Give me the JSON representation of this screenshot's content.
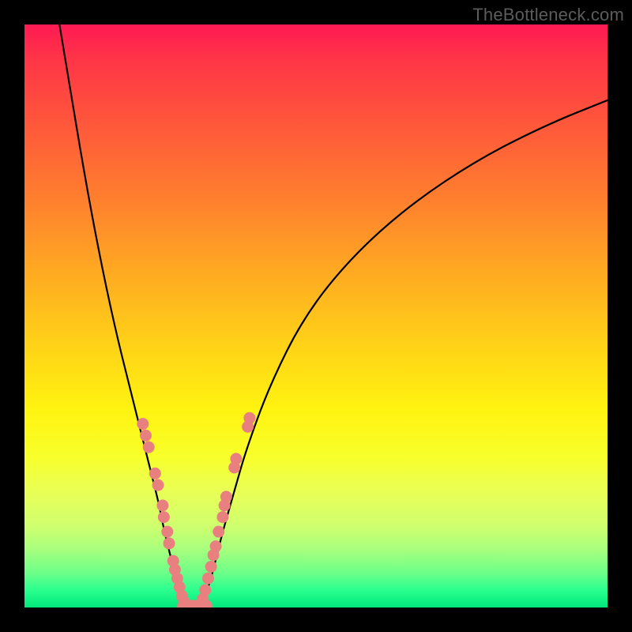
{
  "watermark": "TheBottleneck.com",
  "colors": {
    "background": "#000000",
    "curve_stroke": "#000000",
    "dot_fill": "#e98080",
    "gradient_stops": [
      "#ff1a53",
      "#ff3547",
      "#ff5a3a",
      "#ff7f2e",
      "#ffa822",
      "#ffcf18",
      "#fff310",
      "#f8ff2a",
      "#e9ff55",
      "#cfff6e",
      "#a8ff7d",
      "#6dff88",
      "#2bff8f",
      "#00e87a"
    ]
  },
  "chart_data": {
    "type": "line",
    "title": "",
    "xlabel": "",
    "ylabel": "",
    "xlim": [
      0,
      100
    ],
    "ylim": [
      0,
      100
    ],
    "grid": false,
    "legend": false,
    "series": [
      {
        "name": "left-curve",
        "x": [
          6,
          8,
          10,
          12,
          14,
          16,
          18,
          20,
          22,
          23,
          24,
          25,
          26,
          27,
          28
        ],
        "y": [
          100,
          88,
          76,
          65,
          55,
          46,
          38,
          30,
          22,
          18,
          13,
          9,
          5,
          2,
          0
        ]
      },
      {
        "name": "right-curve",
        "x": [
          30,
          31,
          32,
          33,
          34,
          36,
          38,
          42,
          48,
          56,
          66,
          78,
          90,
          100
        ],
        "y": [
          0,
          2,
          5,
          9,
          13,
          20,
          27,
          38,
          50,
          60,
          69,
          77,
          83,
          87
        ]
      }
    ],
    "scatter_points": {
      "name": "highlight-dots",
      "points": [
        {
          "x": 20.3,
          "y": 31.5
        },
        {
          "x": 20.8,
          "y": 29.5
        },
        {
          "x": 21.3,
          "y": 27.5
        },
        {
          "x": 22.4,
          "y": 23
        },
        {
          "x": 22.9,
          "y": 21
        },
        {
          "x": 23.7,
          "y": 17.5
        },
        {
          "x": 23.9,
          "y": 15.5
        },
        {
          "x": 24.5,
          "y": 13
        },
        {
          "x": 24.8,
          "y": 11
        },
        {
          "x": 25.5,
          "y": 8
        },
        {
          "x": 25.8,
          "y": 6.5
        },
        {
          "x": 26.2,
          "y": 5
        },
        {
          "x": 26.6,
          "y": 3.5
        },
        {
          "x": 27,
          "y": 2
        },
        {
          "x": 27.4,
          "y": 1
        },
        {
          "x": 27.2,
          "y": 0.3
        },
        {
          "x": 28,
          "y": 0.3
        },
        {
          "x": 28.8,
          "y": 0.3
        },
        {
          "x": 29.6,
          "y": 0.3
        },
        {
          "x": 30.4,
          "y": 0.3
        },
        {
          "x": 31.2,
          "y": 0.3
        },
        {
          "x": 30.6,
          "y": 1.5
        },
        {
          "x": 31,
          "y": 3
        },
        {
          "x": 31.5,
          "y": 5
        },
        {
          "x": 32,
          "y": 7
        },
        {
          "x": 32.4,
          "y": 9
        },
        {
          "x": 32.8,
          "y": 10.5
        },
        {
          "x": 33.3,
          "y": 13
        },
        {
          "x": 34,
          "y": 15.5
        },
        {
          "x": 34.3,
          "y": 17.5
        },
        {
          "x": 34.6,
          "y": 19
        },
        {
          "x": 36,
          "y": 24
        },
        {
          "x": 36.3,
          "y": 25.5
        },
        {
          "x": 38.3,
          "y": 31
        },
        {
          "x": 38.6,
          "y": 32.5
        }
      ]
    }
  }
}
